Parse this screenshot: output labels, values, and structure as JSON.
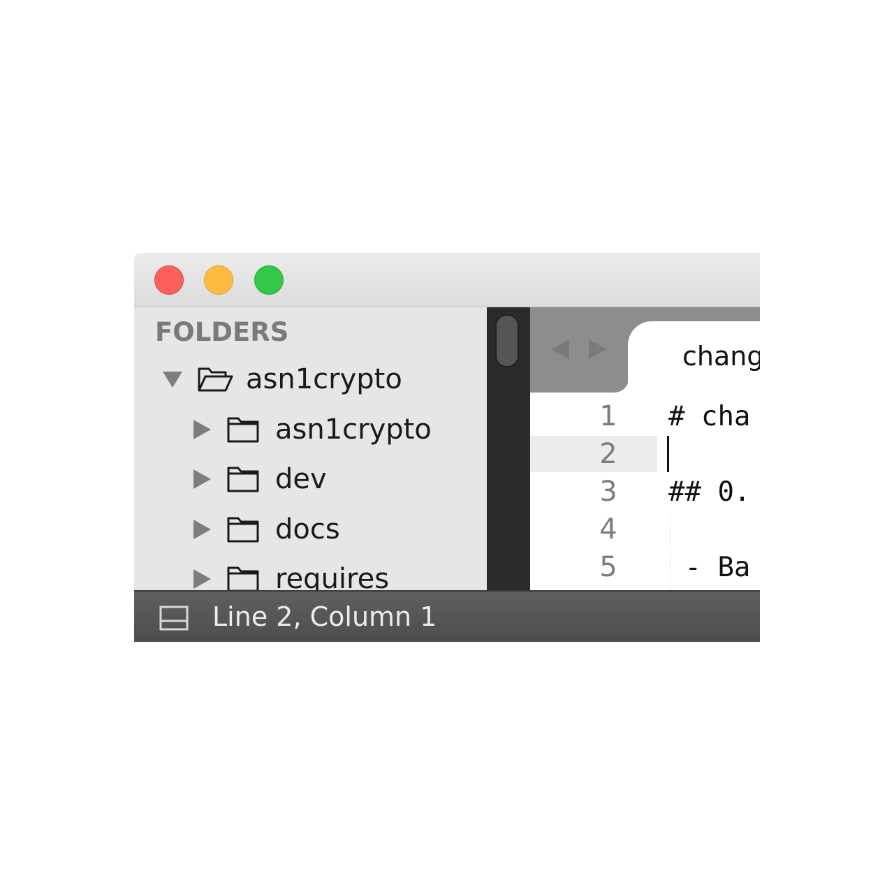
{
  "sidebar": {
    "heading": "FOLDERS",
    "tree": [
      {
        "label": "asn1crypto",
        "expanded": true,
        "level": 0
      },
      {
        "label": "asn1crypto",
        "expanded": false,
        "level": 1
      },
      {
        "label": "dev",
        "expanded": false,
        "level": 1
      },
      {
        "label": "docs",
        "expanded": false,
        "level": 1
      },
      {
        "label": "requires",
        "expanded": false,
        "level": 1
      }
    ]
  },
  "tabs": [
    {
      "label": "chang",
      "active": true
    }
  ],
  "editor": {
    "line_numbers": [
      "1",
      "2",
      "3",
      "4",
      "5"
    ],
    "lines": [
      "# cha",
      "",
      "## 0.",
      "",
      " - Ba"
    ],
    "current_line": 2
  },
  "statusbar": {
    "position": "Line 2, Column 1"
  },
  "colors": {
    "close": "#fc605c",
    "minimize": "#fdbc40",
    "maximize": "#34c84a",
    "sidebar_bg": "#e6e6e6",
    "statusbar_bg": "#555555"
  },
  "icons": {
    "panel": "panel-toggle-icon",
    "folder_open": "folder-open-icon",
    "folder_closed": "folder-icon",
    "disclosure_down": "triangle-down-icon",
    "disclosure_right": "triangle-right-icon"
  }
}
